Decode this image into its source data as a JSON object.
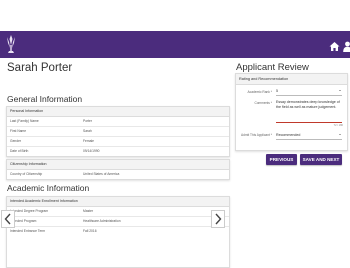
{
  "student": {
    "name": "Sarah Porter"
  },
  "sections": {
    "general_information": "General Information",
    "academic_information": "Academic Information",
    "applicant_review": "Applicant Review"
  },
  "personal_information": {
    "title": "Personal Information",
    "rows": [
      {
        "label": "Last (Family) Name",
        "value": "Porter"
      },
      {
        "label": "First Name",
        "value": "Sarah"
      },
      {
        "label": "Gender",
        "value": "Female"
      },
      {
        "label": "Date of Birth",
        "value": "09/14/1990"
      }
    ]
  },
  "citizenship_information": {
    "title": "Citizenship Information",
    "rows": [
      {
        "label": "Country of Citizenship",
        "value": "United States of America"
      }
    ]
  },
  "enrollment_information": {
    "title": "Intended Academic Enrollment Information",
    "rows": [
      {
        "label": "Intended Degree Program",
        "value": "Master"
      },
      {
        "label": "Intended Program",
        "value": "Healthcare Administration"
      },
      {
        "label": "Intended Entrance Term",
        "value": "Fall 2016"
      }
    ]
  },
  "review": {
    "card_title": "Rating and Recommendation",
    "academic_rank_label": "Academic Rank *",
    "academic_rank_value": "5",
    "comments_label": "Comments *",
    "comments_value": "Essay demonstrates deep knowledge of the field as well as mature judgement.",
    "counter": "72 / 180",
    "admit_label": "Admit This Applicant *",
    "admit_value": "Recommended"
  },
  "buttons": {
    "previous": "PREVIOUS",
    "save_next": "SAVE AND NEXT"
  },
  "colors": {
    "brand": "#4b2c7d",
    "error_underline": "#c0392b"
  },
  "icons": {
    "logo": "university-crest-icon",
    "home": "home-icon",
    "user": "user-icon",
    "prev": "chevron-left-icon",
    "next": "chevron-right-icon"
  }
}
